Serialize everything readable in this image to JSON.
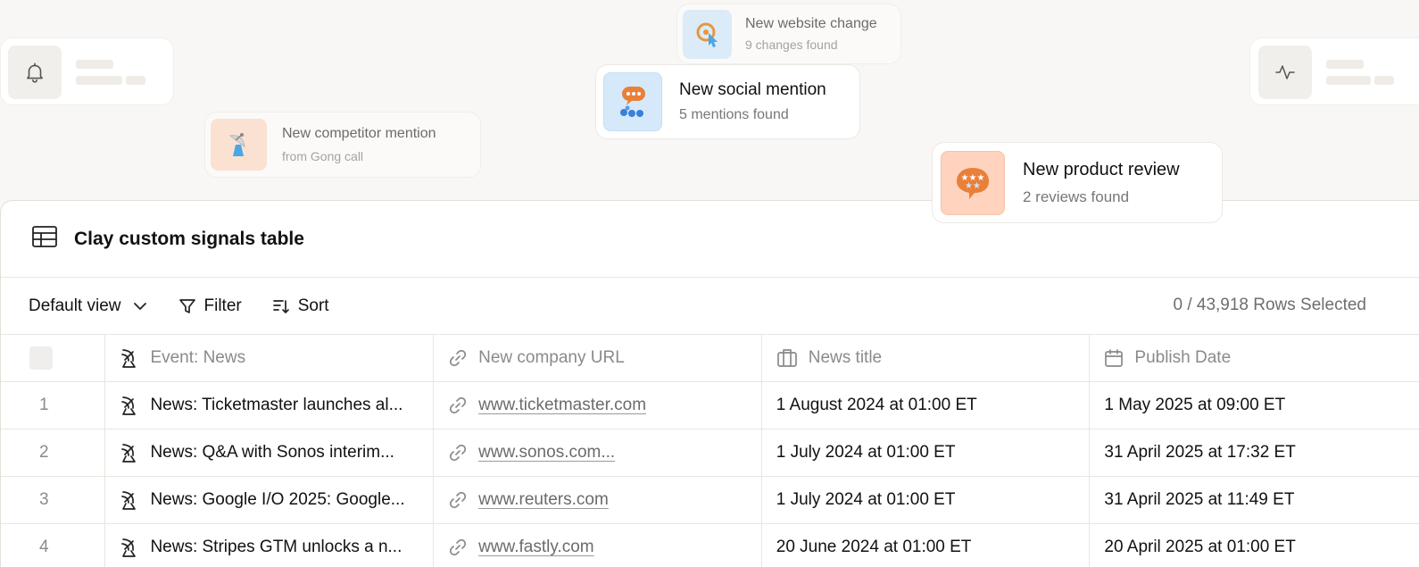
{
  "signals": {
    "website_change": {
      "title": "New website change",
      "subtitle": "9 changes found",
      "icon": "cursor-target-icon"
    },
    "social_mention": {
      "title": "New social mention",
      "subtitle": "5 mentions found",
      "icon": "speech-bubble-people-icon"
    },
    "competitor_mention": {
      "title": "New competitor mention",
      "subtitle": "from Gong call",
      "icon": "satellite-dish-icon"
    },
    "product_review": {
      "title": "New product review",
      "subtitle": "2 reviews found",
      "icon": "star-review-bubble-icon"
    },
    "left_placeholder": {
      "icon": "bell-icon"
    },
    "right_placeholder": {
      "icon": "activity-pulse-icon"
    }
  },
  "table": {
    "title": "Clay custom signals table",
    "toolbar": {
      "view_label": "Default view",
      "filter_label": "Filter",
      "sort_label": "Sort",
      "rows_selected": "0 / 43,918 Rows Selected"
    },
    "columns": [
      "Event: News",
      "New company URL",
      "News title",
      "Publish Date"
    ],
    "rows": [
      {
        "index": "1",
        "event": "News: Ticketmaster launches al...",
        "url": "www.ticketmaster.com",
        "news_title": "1 August 2024 at 01:00 ET",
        "publish_date": "1 May 2025 at 09:00 ET"
      },
      {
        "index": "2",
        "event": "News: Q&A with Sonos interim...",
        "url": "www.sonos.com...",
        "news_title": "1 July 2024 at 01:00 ET",
        "publish_date": "31 April 2025 at 17:32 ET"
      },
      {
        "index": "3",
        "event": "News: Google I/O 2025: Google...",
        "url": "www.reuters.com",
        "news_title": "1 July 2024 at 01:00 ET",
        "publish_date": "31 April 2025 at 11:49 ET"
      },
      {
        "index": "4",
        "event": "News: Stripes GTM unlocks a n...",
        "url": "www.fastly.com",
        "news_title": "20 June 2024 at 01:00 ET",
        "publish_date": "20 April 2025 at 01:00 ET"
      }
    ]
  },
  "colors": {
    "background": "#f8f7f5",
    "icon_blue_bg": "#d8ebfb",
    "icon_orange_bg": "#ffd6bf",
    "muted_text": "#8a8a8a"
  }
}
